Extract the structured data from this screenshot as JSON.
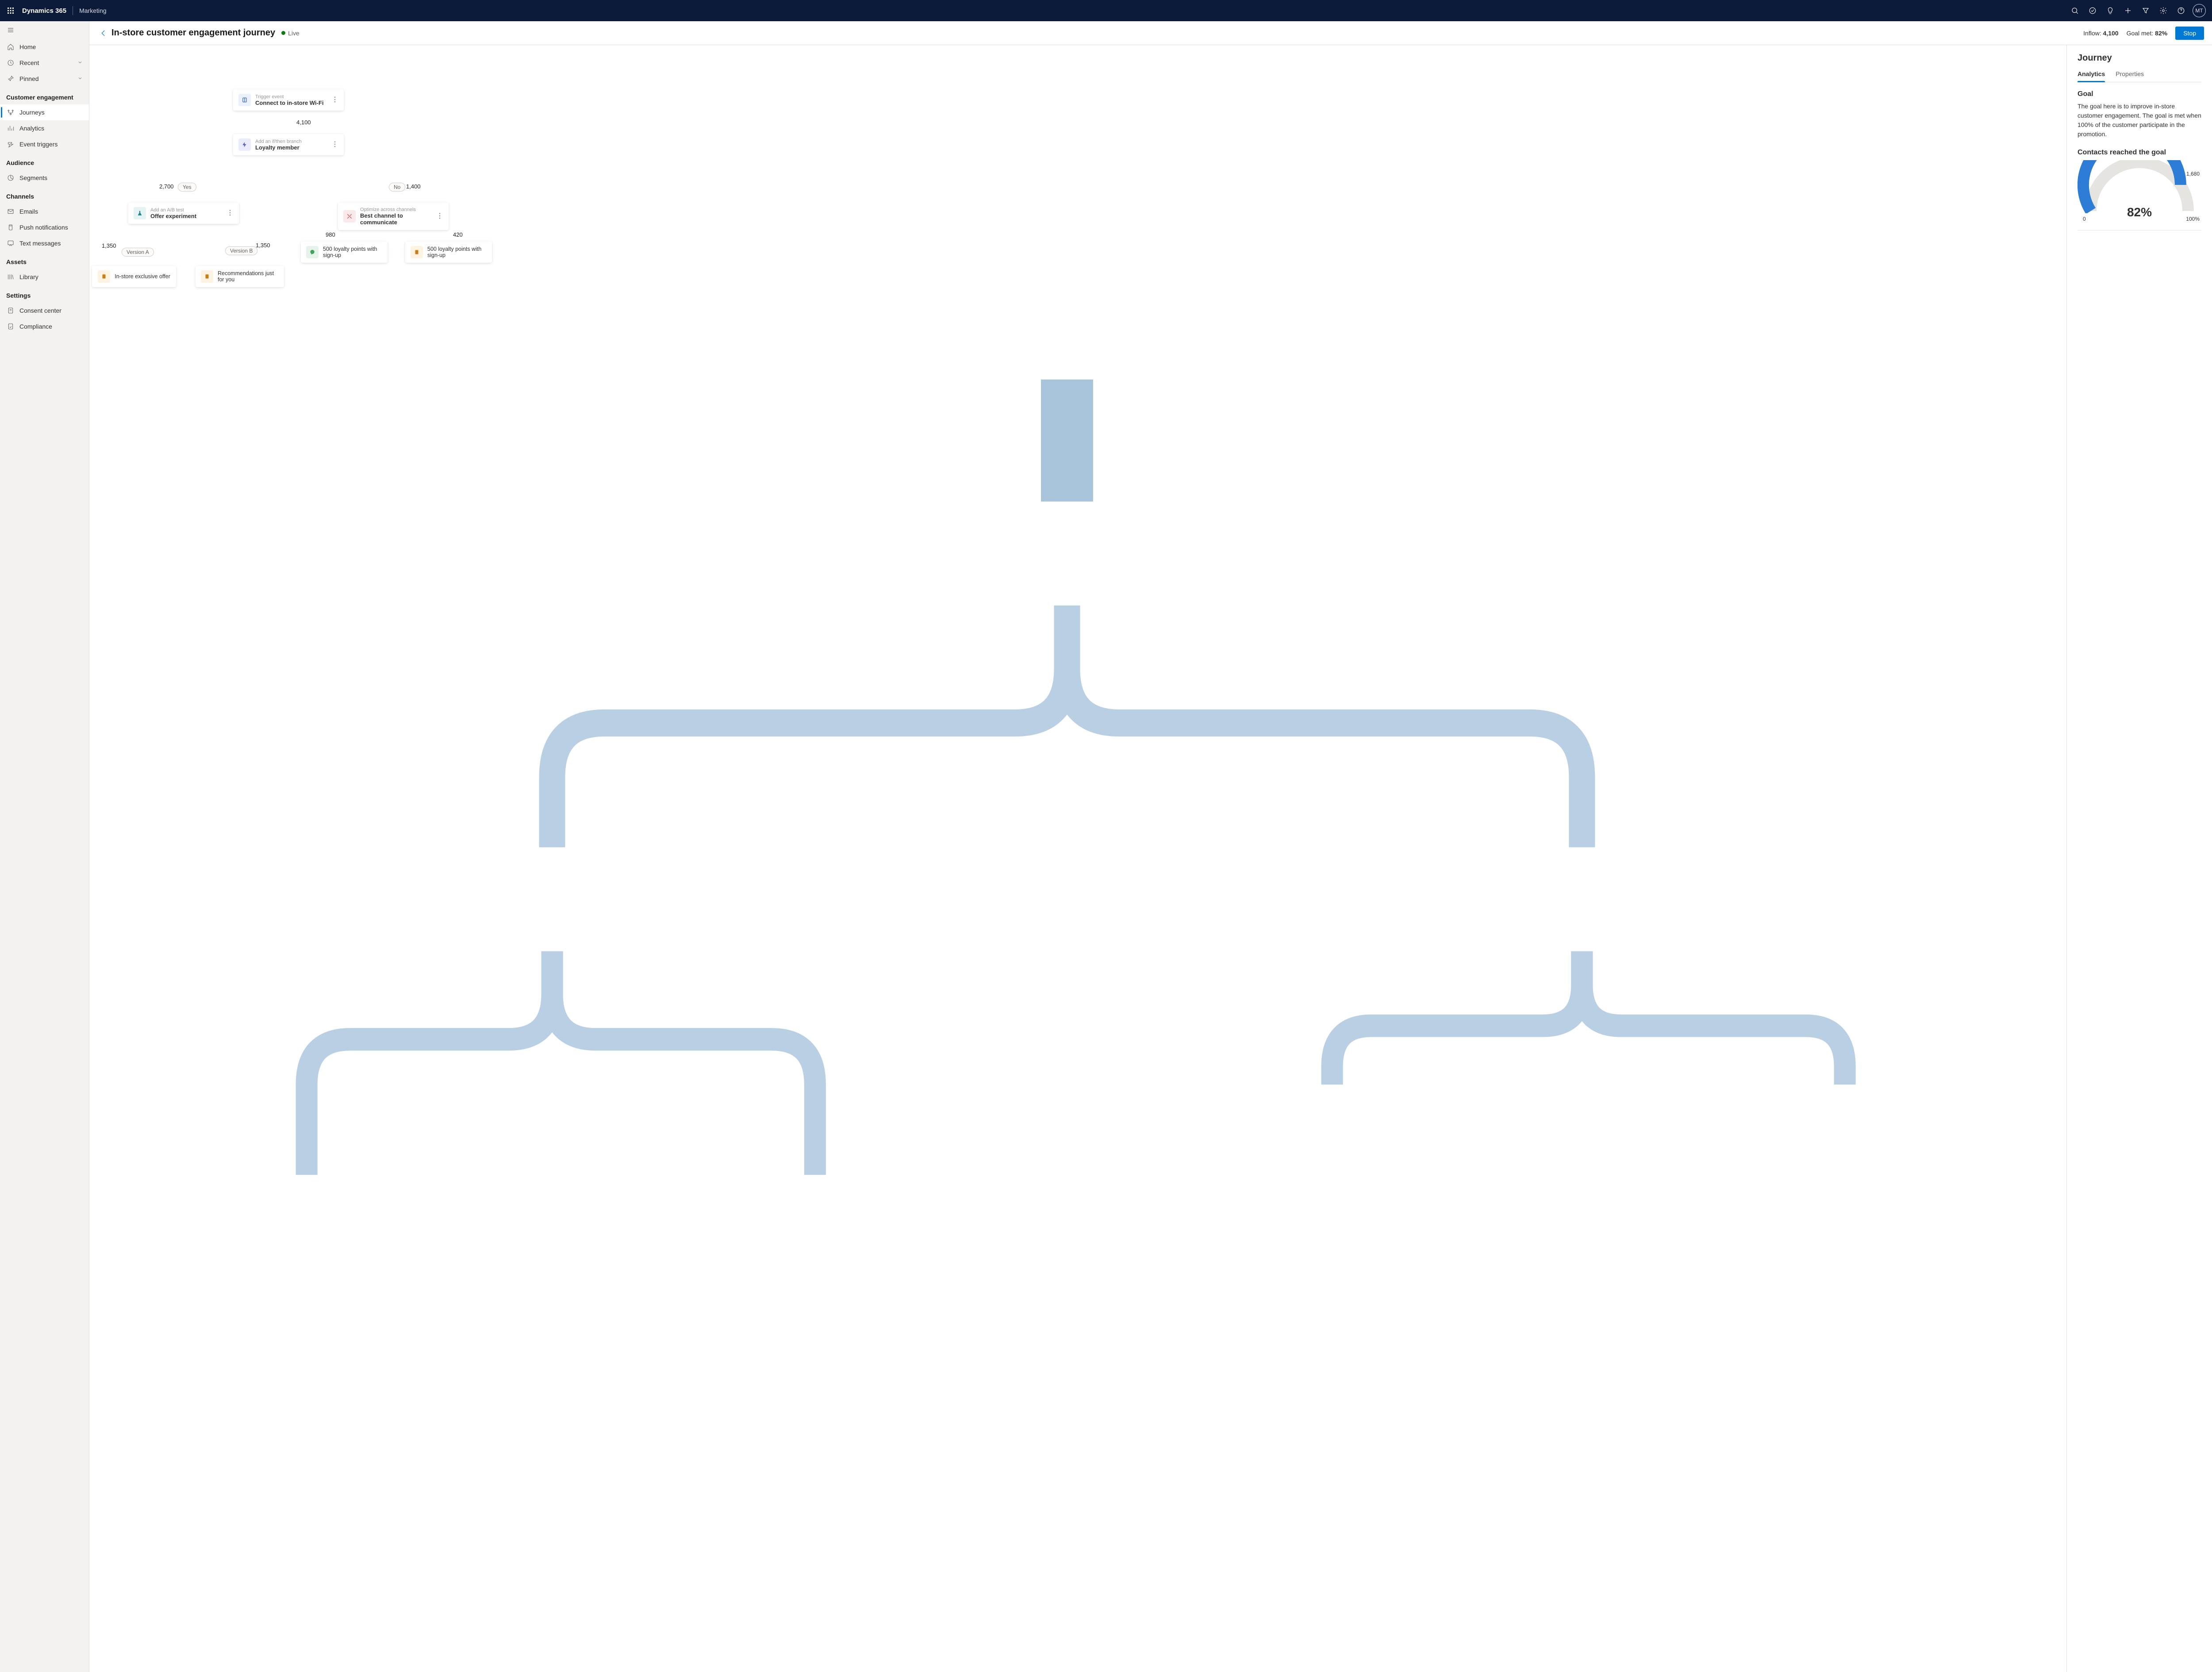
{
  "topbar": {
    "brand": "Dynamics 365",
    "area": "Marketing",
    "avatar_initials": "MT"
  },
  "sidebar": {
    "top_items": [
      {
        "label": "Home"
      },
      {
        "label": "Recent"
      },
      {
        "label": "Pinned"
      }
    ],
    "sections": [
      {
        "heading": "Customer engagement",
        "items": [
          {
            "label": "Journeys",
            "active": true
          },
          {
            "label": "Analytics"
          },
          {
            "label": "Event triggers"
          }
        ]
      },
      {
        "heading": "Audience",
        "items": [
          {
            "label": "Segments"
          }
        ]
      },
      {
        "heading": "Channels",
        "items": [
          {
            "label": "Emails"
          },
          {
            "label": "Push notifications"
          },
          {
            "label": "Text messages"
          }
        ]
      },
      {
        "heading": "Assets",
        "items": [
          {
            "label": "Library"
          }
        ]
      },
      {
        "heading": "Settings",
        "items": [
          {
            "label": "Consent center"
          },
          {
            "label": "Compliance"
          }
        ]
      }
    ]
  },
  "page": {
    "title": "In-store customer engagement journey",
    "status": "Live",
    "inflow_label": "Inflow:",
    "inflow_value": "4,100",
    "goal_label": "Goal met:",
    "goal_value": "82%",
    "stop": "Stop"
  },
  "journey": {
    "trigger": {
      "category": "Trigger event",
      "label": "Connect to in-store Wi-Fi",
      "count": "4,100"
    },
    "branch": {
      "category": "Add an if/then branch",
      "label": "Loyalty member"
    },
    "yes_count": "2,700",
    "yes_label": "Yes",
    "no_count": "1,400",
    "no_label": "No",
    "ab": {
      "category": "Add an A/B test",
      "label": "Offer experiment"
    },
    "ab_a_label": "Version A",
    "ab_a_count": "1,350",
    "ab_b_label": "Version B",
    "ab_b_count": "1,350",
    "leaf_a": "In-store exclusive offer",
    "leaf_b": "Recommendations just for you",
    "optimize": {
      "category": "Optimize across channels",
      "label": "Best channel to communicate"
    },
    "opt1_count": "980",
    "opt2_count": "420",
    "opt1": "500 loyalty points with sign-up",
    "opt2": "500 loyalty points with sign-up"
  },
  "rpanel": {
    "heading": "Journey",
    "tabs": {
      "analytics": "Analytics",
      "properties": "Properties"
    },
    "goal_heading": "Goal",
    "goal_text": "The goal here is to improve in-store customer engagement. The goal is met when 100% of the customer participate in the promotion.",
    "contacts_heading": "Contacts reached the goal",
    "gauge": {
      "percent_txt": "82%",
      "low": "0",
      "high": "100%",
      "value": "1,680",
      "percent": 82
    }
  },
  "chart_data": {
    "type": "bar",
    "title": "Contacts reached the goal",
    "categories": [
      "Goal met"
    ],
    "values": [
      82
    ],
    "value_absolute": 1680,
    "ylabel": "",
    "xlabel": "",
    "ylim": [
      0,
      100
    ]
  },
  "colors": {
    "primary": "#0078d4",
    "connector": "#b9cfe3",
    "connector_main": "#9dc0de",
    "icon_blue_bg": "#eaf1fc",
    "icon_purple_bg": "#e9ebf9",
    "icon_teal_bg": "#e5f3f4",
    "icon_pink_bg": "#fbe9ea",
    "icon_orange_bg": "#fdf3e0",
    "icon_green_bg": "#e6f3ea"
  }
}
